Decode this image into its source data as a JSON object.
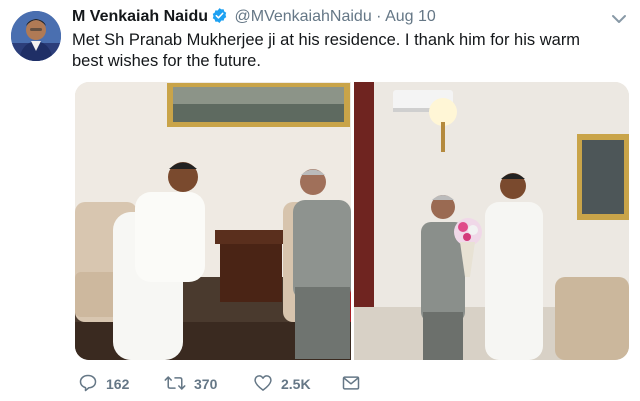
{
  "tweet": {
    "name": "M Venkaiah Naidu",
    "handle": "@MVenkaiahNaidu",
    "separator": "·",
    "date": "Aug 10",
    "text": "Met Sh Pranab Mukherjee ji at his residence. I thank him for his warm best wishes for the future.",
    "icons": {
      "avatar": "profile-photo",
      "verified": "verified-badge-icon",
      "menu": "chevron-down-icon"
    }
  },
  "actions": {
    "reply_count": "162",
    "retweet_count": "370",
    "like_count": "2.5K"
  },
  "colors": {
    "verified": "#1da1f2",
    "secondary_text": "#657786"
  }
}
